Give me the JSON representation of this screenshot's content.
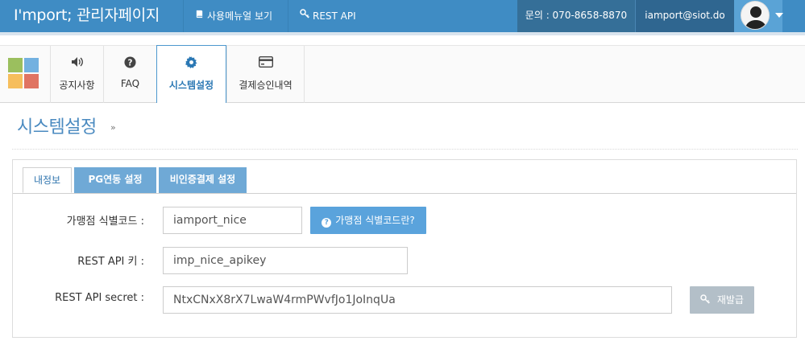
{
  "header": {
    "brand": "I'mport; 관리자페이지",
    "nav": [
      {
        "icon": "book-icon",
        "label": "사용메뉴얼 보기"
      },
      {
        "icon": "key-icon",
        "label": "REST API"
      }
    ],
    "contact": "문의 : 070-8658-8870",
    "email": "iamport@siot.do"
  },
  "modules": [
    {
      "icon": "speaker-icon",
      "label": "공지사항"
    },
    {
      "icon": "question-circle-icon",
      "label": "FAQ"
    },
    {
      "icon": "gear-icon",
      "label": "시스템설정",
      "active": true
    },
    {
      "icon": "credit-card-icon",
      "label": "결제승인내역"
    }
  ],
  "page": {
    "title": "시스템설정",
    "chevron": "»"
  },
  "tabs": [
    {
      "label": "내정보",
      "active": true
    },
    {
      "label": "PG연동 설정"
    },
    {
      "label": "비인증결제 설정"
    }
  ],
  "form": {
    "merchant_code_label": "가맹점 식별코드 :",
    "merchant_code_value": "iamport_nice",
    "help_button": "가맹점 식별코드란?",
    "api_key_label": "REST API 키 :",
    "api_key_value": "imp_nice_apikey",
    "api_secret_label": "REST API secret :",
    "api_secret_value": "NtxCNxX8rX7LwaW4rmPWvfJo1JoInqUa",
    "reissue_button": "재발급"
  },
  "colors": {
    "navbar": "#3f8cc4",
    "accent": "#5aa3dc",
    "tab_inactive": "#6fa9d6",
    "disabled_button": "#b3bfc8"
  }
}
